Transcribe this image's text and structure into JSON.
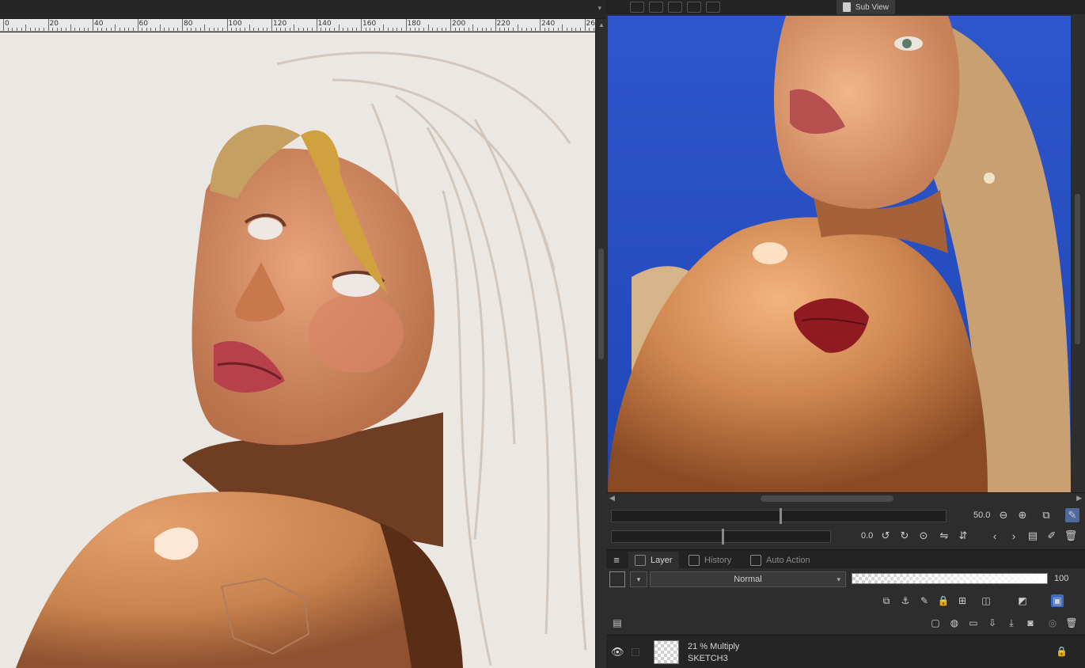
{
  "canvas_ruler": {
    "labels": [
      "0",
      "20",
      "40",
      "60",
      "80",
      "100",
      "120",
      "140",
      "160",
      "180",
      "200",
      "220",
      "240",
      "26"
    ]
  },
  "sub_view": {
    "tab_label": "Sub View"
  },
  "navigator": {
    "zoom_value": "50.0",
    "rotation_value": "0.0"
  },
  "layer_panel": {
    "tabs": [
      {
        "label": "Layer",
        "icon": "layer-cube-icon"
      },
      {
        "label": "History",
        "icon": "history-icon"
      },
      {
        "label": "Auto Action",
        "icon": "auto-action-icon"
      }
    ],
    "blend_mode": "Normal",
    "opacity": "100",
    "layers": [
      {
        "info": "21 % Multiply",
        "name": "SKETCH3"
      }
    ]
  },
  "colors": {
    "panel_bg": "#2d2d2d",
    "ref_sky": "#2a4fc3",
    "canvas_paper": "#ebe8e3",
    "active_blue": "#4d6a9b"
  }
}
